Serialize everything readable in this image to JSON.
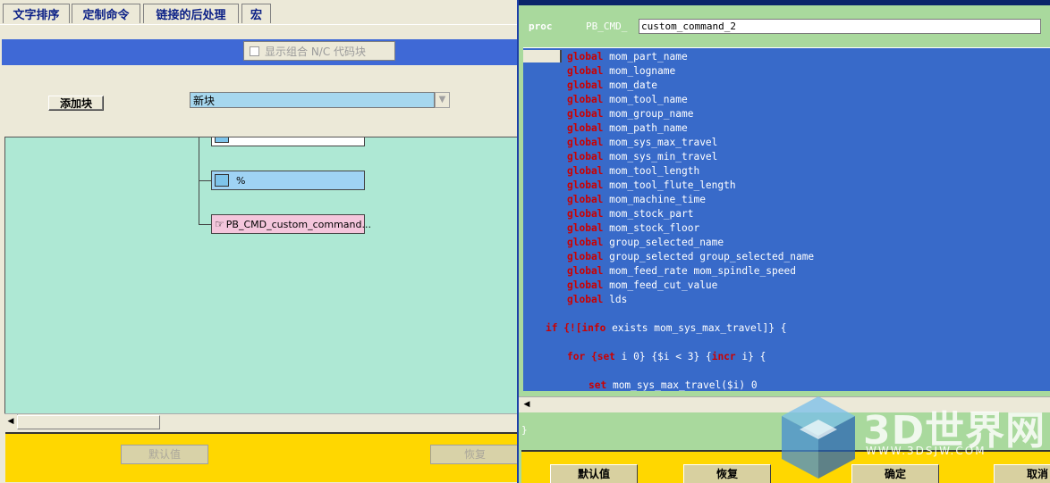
{
  "tabs": [
    "文字排序",
    "定制命令",
    "链接的后处理",
    "宏"
  ],
  "left": {
    "checkbox_label": "显示组合 N/C 代码块",
    "add_block_label": "添加块",
    "combo_value": "新块",
    "tree_nodes": [
      "%",
      "PB_CMD_custom_command..."
    ],
    "buttons": [
      "默认值",
      "恢复"
    ]
  },
  "right": {
    "proc_keyword": "proc",
    "proc_prefix": "PB_CMD_",
    "proc_name": "custom_command_2",
    "globals": [
      "mom_part_name",
      "mom_logname",
      "mom_date",
      "mom_tool_name",
      "mom_group_name",
      "mom_path_name",
      "mom_sys_max_travel",
      "mom_sys_min_travel",
      "mom_tool_length",
      "mom_tool_flute_length",
      "mom_machine_time",
      "mom_stock_part",
      "mom_stock_floor",
      "group_selected_name",
      "group_selected group_selected_name",
      "mom_feed_rate mom_spindle_speed",
      "mom_feed_cut_value",
      "lds"
    ],
    "global_kw": "global",
    "if_line": {
      "kw1": "if",
      "p1": " {![",
      "kw2": "info",
      "p2": " exists mom_sys_max_travel]} {"
    },
    "for_line": {
      "kw1": "for",
      "p1": " {",
      "kw2": "set",
      "p2": " i 0} {$i < 3} {",
      "kw3": "incr",
      "p3": " i} {"
    },
    "set_line": {
      "kw1": "set",
      "p1": " mom_sys_max_travel($i) 0"
    },
    "closing_brace": "}",
    "buttons": [
      "默认值",
      "恢复",
      "确定",
      "取消"
    ]
  },
  "watermark": {
    "text": "3D世界网",
    "url": "WWW.3DSJW.COM"
  },
  "colors": {
    "editor_bg": "#386ac9",
    "keyword": "#cc0000",
    "yellow": "#ffd700",
    "green": "#a9d99d",
    "tree_bg": "#aee8d4"
  }
}
